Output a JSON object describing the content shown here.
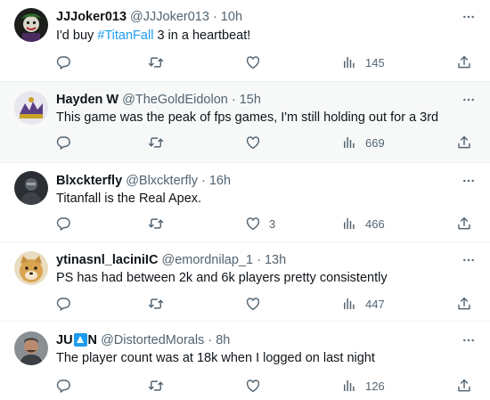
{
  "colors": {
    "link": "#1d9bf0",
    "secondary_text": "#536471",
    "primary_text": "#0f1419",
    "hover_background": "#f7f9f9",
    "divider": "#eff3f4"
  },
  "icons": {
    "reply": "speech-bubble-icon",
    "retweet": "retweet-arrows-icon",
    "like": "heart-icon",
    "views": "bar-chart-icon",
    "share": "share-upload-icon",
    "more": "more-dots-icon"
  },
  "tweets": [
    {
      "display_name": "JJJoker013",
      "handle": "@JJJoker013",
      "time": "· 10h",
      "text_before": "I'd buy ",
      "hashtag": "#TitanFall",
      "text_after": " 3 in a heartbeat!",
      "likes": "",
      "views": "145"
    },
    {
      "display_name": "Hayden W",
      "handle": "@TheGoldEidolon",
      "time": "· 15h",
      "text": "This game was the peak of fps games, I'm still holding out for a 3rd",
      "likes": "",
      "views": "669"
    },
    {
      "display_name": "Blxckterfly",
      "handle": "@Blxckterfly",
      "time": "· 16h",
      "text": "Titanfall is the Real Apex.",
      "likes": "3",
      "views": "466"
    },
    {
      "display_name": "ytinasnl_laciniIC",
      "handle": "@emordnilap_1",
      "time": "· 13h",
      "text": "PS has had between 2k and 6k players pretty consistently",
      "likes": "",
      "views": "447"
    },
    {
      "display_name_prefix": "JU",
      "display_name_suffix": "N",
      "handle": "@DistortedMorals",
      "time": "· 8h",
      "text": "The player count was at 18k when I logged on last night",
      "likes": "",
      "views": "126"
    }
  ]
}
